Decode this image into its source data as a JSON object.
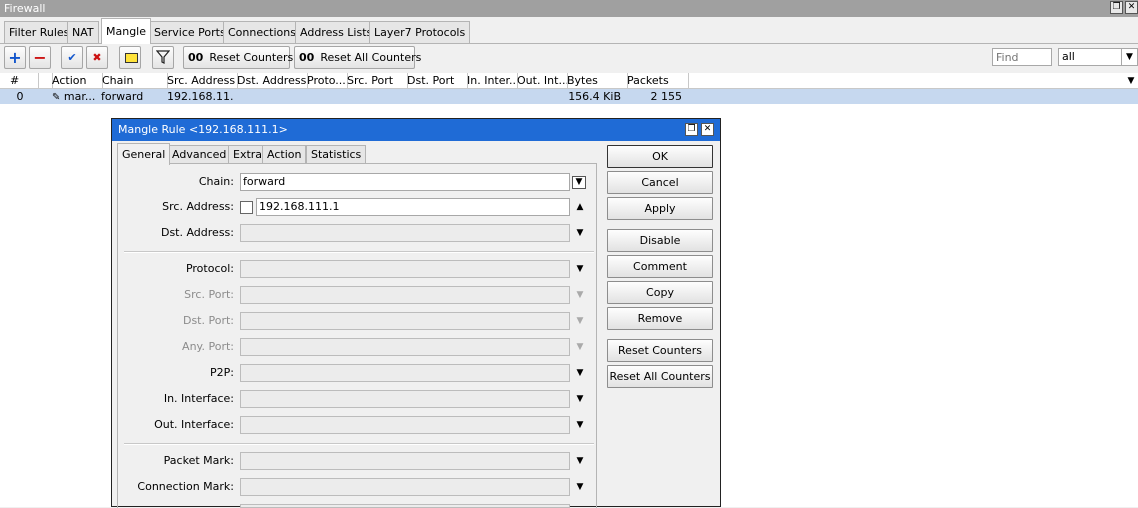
{
  "window": {
    "title": "Firewall",
    "restore_icon": "restore-icon",
    "close_icon": "close-icon"
  },
  "tabs": [
    {
      "label": "Filter Rules"
    },
    {
      "label": "NAT"
    },
    {
      "label": "Mangle",
      "active": true
    },
    {
      "label": "Service Ports"
    },
    {
      "label": "Connections"
    },
    {
      "label": "Address Lists"
    },
    {
      "label": "Layer7 Protocols"
    }
  ],
  "toolbar": {
    "add_icon": "plus-icon",
    "remove_icon": "minus-icon",
    "enable_icon": "check-icon",
    "disable_icon": "x-icon",
    "comment_icon": "note-icon",
    "filter_icon": "filter-icon",
    "counter_prefix": "00",
    "reset_counters": "Reset Counters",
    "reset_all_counters": "Reset All Counters",
    "find_placeholder": "Find",
    "filter_select": "all"
  },
  "grid": {
    "columns": [
      "#",
      "",
      "Action",
      "Chain",
      "Src. Address",
      "Dst. Address",
      "Proto...",
      "Src. Port",
      "Dst. Port",
      "In. Inter...",
      "Out. Int...",
      "Bytes",
      "Packets"
    ],
    "rows": [
      {
        "num": "0",
        "action": "mar...",
        "chain": "forward",
        "src": "192.168.11...",
        "bytes": "156.4 KiB",
        "packets": "2 155"
      }
    ]
  },
  "dialog": {
    "title": "Mangle Rule <192.168.111.1>",
    "tabs": [
      "General",
      "Advanced",
      "Extra",
      "Action",
      "Statistics"
    ],
    "fields": {
      "chain": {
        "label": "Chain:",
        "value": "forward"
      },
      "src_address": {
        "label": "Src. Address:",
        "value": "192.168.111.1"
      },
      "dst_address": {
        "label": "Dst. Address:"
      },
      "protocol": {
        "label": "Protocol:"
      },
      "src_port": {
        "label": "Src. Port:"
      },
      "dst_port": {
        "label": "Dst. Port:"
      },
      "any_port": {
        "label": "Any. Port:"
      },
      "p2p": {
        "label": "P2P:"
      },
      "in_interface": {
        "label": "In. Interface:"
      },
      "out_interface": {
        "label": "Out. Interface:"
      },
      "packet_mark": {
        "label": "Packet Mark:"
      },
      "connection_mark": {
        "label": "Connection Mark:"
      }
    },
    "buttons": {
      "ok": "OK",
      "cancel": "Cancel",
      "apply": "Apply",
      "disable": "Disable",
      "comment": "Comment",
      "copy": "Copy",
      "remove": "Remove",
      "reset_counters": "Reset Counters",
      "reset_all_counters": "Reset All Counters"
    }
  }
}
